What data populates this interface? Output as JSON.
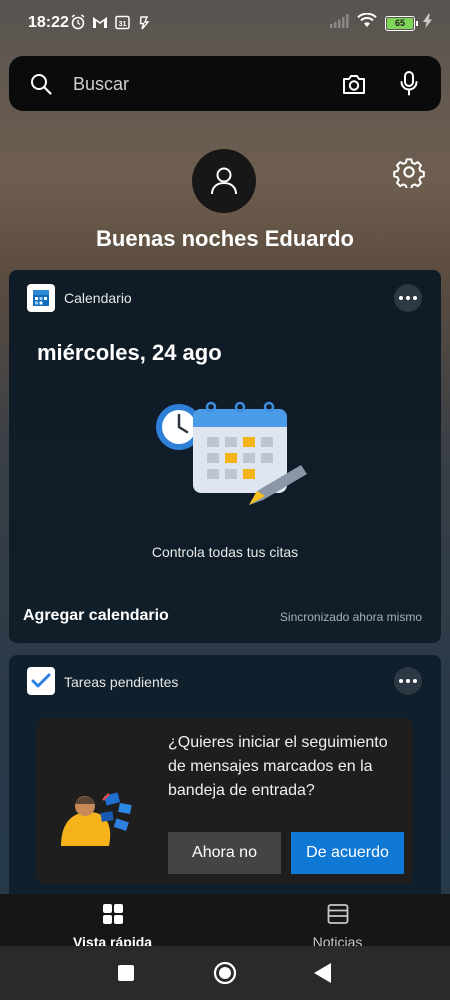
{
  "status_bar": {
    "time": "18:22",
    "calendar_badge": "31",
    "battery_level": "65",
    "icons": [
      "alarm-icon",
      "gmail-icon",
      "calendar-icon",
      "notification-icon",
      "signal-icon",
      "wifi-icon",
      "battery-icon",
      "charging-icon"
    ]
  },
  "search": {
    "placeholder": "Buscar"
  },
  "greeting": "Buenas noches Eduardo",
  "calendar_card": {
    "title": "Calendario",
    "date": "miércoles, 24 ago",
    "caption": "Controla todas tus citas",
    "add_label": "Agregar calendario",
    "sync_status": "Sincronizado ahora mismo"
  },
  "tasks_card": {
    "title": "Tareas pendientes",
    "prompt_text": "¿Quieres iniciar el seguimiento de mensajes marcados en la bandeja de entrada?",
    "no_label": "Ahora no",
    "yes_label": "De acuerdo"
  },
  "tabs": [
    {
      "label": "Vista rápida",
      "icon": "grid-icon",
      "active": true
    },
    {
      "label": "Noticias",
      "icon": "news-icon",
      "active": false
    }
  ],
  "colors": {
    "accent_blue": "#0f78d4",
    "card_bg": "#0f1b26",
    "search_bg": "#0b0b0c",
    "battery_green": "#7fd65a"
  }
}
